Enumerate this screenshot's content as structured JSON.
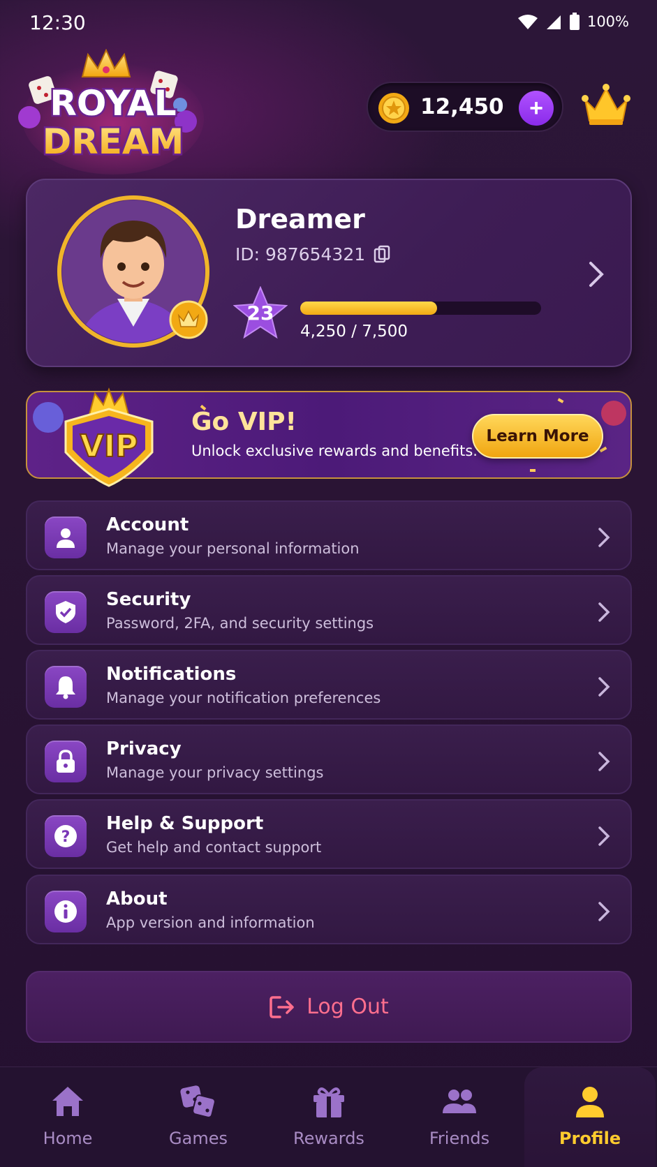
{
  "status_bar": {
    "time": "12:30",
    "battery": "100%"
  },
  "brand": {
    "line1": "ROYAL",
    "line2": "DREAM"
  },
  "wallet": {
    "coins": "12,450"
  },
  "profile": {
    "name": "Dreamer",
    "id": "ID: 987654321",
    "level": "23",
    "xp_text": "4,250 / 7,500",
    "xp_progress": 0.567
  },
  "vip": {
    "badge": "VIP",
    "title": "Go VIP!",
    "subtitle": "Unlock exclusive rewards and benefits.",
    "button": "Learn More"
  },
  "menu": [
    {
      "icon": "user-icon",
      "title": "Account",
      "subtitle": "Manage your personal information"
    },
    {
      "icon": "shield-icon",
      "title": "Security",
      "subtitle": "Password, 2FA, and security settings"
    },
    {
      "icon": "bell-icon",
      "title": "Notifications",
      "subtitle": "Manage your notification preferences"
    },
    {
      "icon": "lock-icon",
      "title": "Privacy",
      "subtitle": "Manage your privacy settings"
    },
    {
      "icon": "help-icon",
      "title": "Help & Support",
      "subtitle": "Get help and contact support"
    },
    {
      "icon": "info-icon",
      "title": "About",
      "subtitle": "App version and information"
    }
  ],
  "logout": "Log Out",
  "nav": [
    {
      "icon": "home-icon",
      "label": "Home"
    },
    {
      "icon": "dice-icon",
      "label": "Games"
    },
    {
      "icon": "gift-icon",
      "label": "Rewards"
    },
    {
      "icon": "friends-icon",
      "label": "Friends"
    },
    {
      "icon": "profile-icon",
      "label": "Profile",
      "active": true
    }
  ],
  "colors": {
    "accent_gold": "#ffcc2e",
    "accent_purple": "#8a2bea",
    "logout_pink": "#ff6f8e",
    "background": "#2a1434"
  }
}
